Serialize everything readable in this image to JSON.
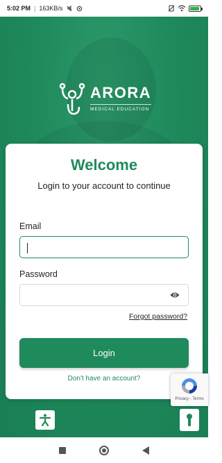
{
  "status_bar": {
    "time": "5:02 PM",
    "net_speed": "163KB/s",
    "battery_level": 0.9
  },
  "brand": {
    "name": "ARORA",
    "tagline": "MEDICAL EDUCATION"
  },
  "login_card": {
    "title": "Welcome",
    "subtitle": "Login to your account to continue",
    "email_label": "Email",
    "email_value": "",
    "password_label": "Password",
    "password_value": "",
    "forgot_label": "Forgot password?",
    "login_label": "Login",
    "signup_label": "Don't have an account?"
  },
  "recaptcha": {
    "links": "Privacy - Terms"
  },
  "colors": {
    "primary": "#1f8a5c",
    "card_bg": "#ffffff"
  },
  "icons": {
    "accessibility": "accessibility-icon",
    "help": "keyhole-icon",
    "password_toggle": "eye-icon"
  }
}
